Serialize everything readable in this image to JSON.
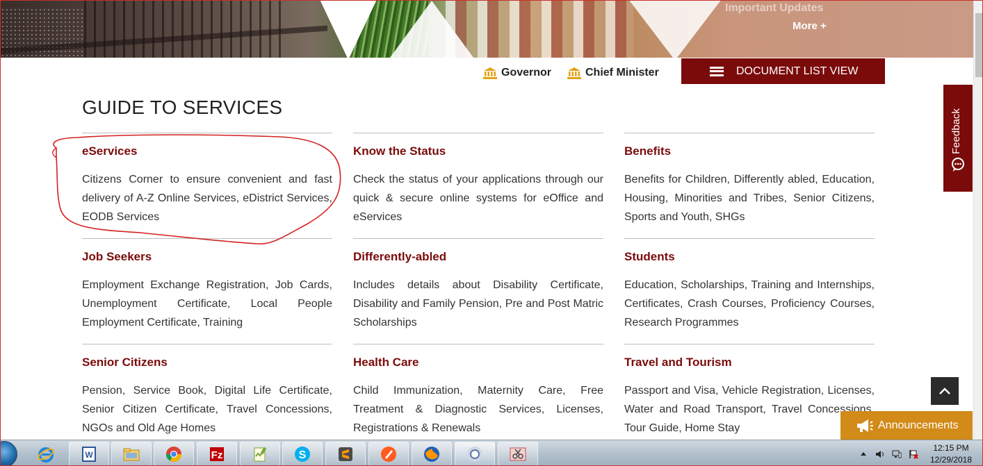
{
  "banner": {
    "updates_title": "Important Updates",
    "more_link": "More +"
  },
  "nav": {
    "governor": "Governor",
    "chief_minister": "Chief Minister",
    "doc_list": "DOCUMENT LIST VIEW"
  },
  "page_title": "GUIDE TO SERVICES",
  "services": [
    {
      "title": "eServices",
      "desc": "Citizens Corner to ensure convenient and fast delivery of A-Z Online Services, eDistrict Services, EODB Services"
    },
    {
      "title": "Know the Status",
      "desc": "Check the status of your applications through our quick & secure online systems for eOffice and eServices"
    },
    {
      "title": "Benefits",
      "desc": "Benefits for Children, Differently abled, Education, Housing, Minorities and Tribes, Senior Citizens, Sports and Youth, SHGs"
    },
    {
      "title": "Job Seekers",
      "desc": "Employment Exchange Registration, Job Cards, Unemployment Certificate, Local People Employment Certificate, Training"
    },
    {
      "title": "Differently-abled",
      "desc": "Includes details about Disability Certificate, Disability and Family Pension, Pre and Post Matric Scholarships"
    },
    {
      "title": "Students",
      "desc": "Education, Scholarships, Training and Internships, Certificates, Crash Courses, Proficiency Courses, Research Programmes"
    },
    {
      "title": "Senior Citizens",
      "desc": "Pension, Service Book, Digital Life Certificate, Senior Citizen Certificate, Travel Concessions, NGOs and Old Age Homes"
    },
    {
      "title": "Health Care",
      "desc": "Child Immunization, Maternity Care, Free Treatment & Diagnostic Services, Licenses, Registrations & Renewals"
    },
    {
      "title": "Travel and Tourism",
      "desc": "Passport and Visa, Vehicle Registration, Licenses, Water and Road Transport, Travel Concessions, Tour Guide, Home Stay"
    }
  ],
  "feedback": "Feedback",
  "announcements": "Announcements",
  "colors": {
    "maroon": "#7b0b0b",
    "announce": "#d28a18",
    "annotation": "#d42020"
  },
  "taskbar": {
    "apps": [
      "internet-explorer",
      "word",
      "file-explorer",
      "chrome",
      "filezilla",
      "notepad-plus-plus",
      "skype",
      "sublime-text",
      "pen-tool",
      "firefox",
      "chrome-canary",
      "snipping-tool"
    ],
    "time": "12:15 PM",
    "date": "12/29/2018"
  }
}
